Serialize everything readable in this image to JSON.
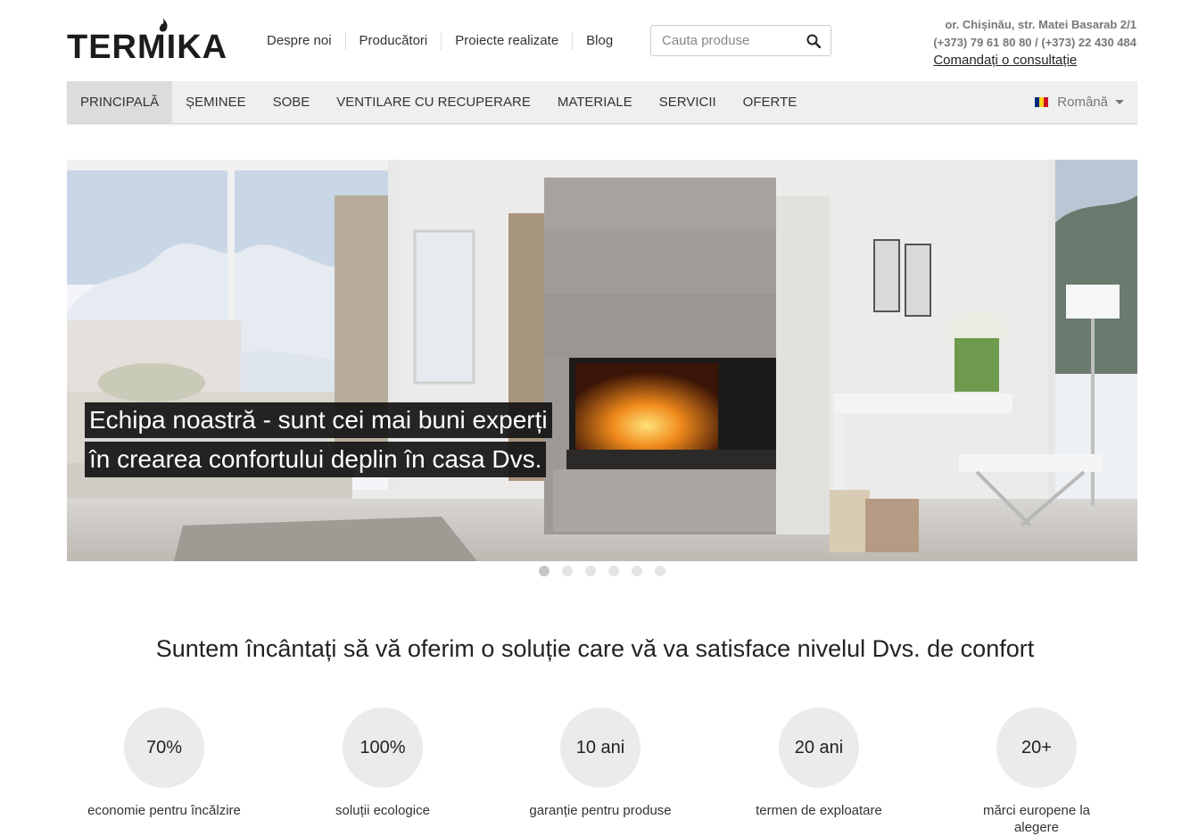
{
  "brand": {
    "name": "TERMIKA"
  },
  "topnav": [
    {
      "label": "Despre noi"
    },
    {
      "label": "Producători"
    },
    {
      "label": "Proiecte realizate"
    },
    {
      "label": "Blog"
    }
  ],
  "search": {
    "placeholder": "Cauta produse",
    "icon": "search-icon"
  },
  "contact": {
    "address": "or. Chișinău, str. Matei Basarab 2/1",
    "phones": "(+373) 79 61 80 80 / (+373) 22 430 484",
    "consult_link": "Comandați o consultație"
  },
  "mainnav": [
    {
      "label": "PRINCIPALĂ",
      "active": true
    },
    {
      "label": "ȘEMINEE"
    },
    {
      "label": "SOBE"
    },
    {
      "label": "VENTILARE CU RECUPERARE"
    },
    {
      "label": "MATERIALE"
    },
    {
      "label": "SERVICII"
    },
    {
      "label": "OFERTE"
    }
  ],
  "language": {
    "label": "Română",
    "flag_colors": [
      "#002B7F",
      "#FCD116",
      "#CE1126"
    ]
  },
  "slider": {
    "caption_line1": "Echipa noastră - sunt cei mai buni experți",
    "caption_line2": "în crearea confortului deplin în casa Dvs.",
    "slide_count": 6,
    "active_slide": 1
  },
  "tagline": "Suntem încântați să vă oferim o soluție care vă va satisface nivelul Dvs. de confort",
  "stats": [
    {
      "value": "70%",
      "label": "economie pentru încălzire"
    },
    {
      "value": "100%",
      "label": "soluții ecologice"
    },
    {
      "value": "10 ani",
      "label": "garanție pentru produse"
    },
    {
      "value": "20 ani",
      "label": "termen de exploatare"
    },
    {
      "value": "20+",
      "label": "mărci europene la alegere"
    }
  ]
}
